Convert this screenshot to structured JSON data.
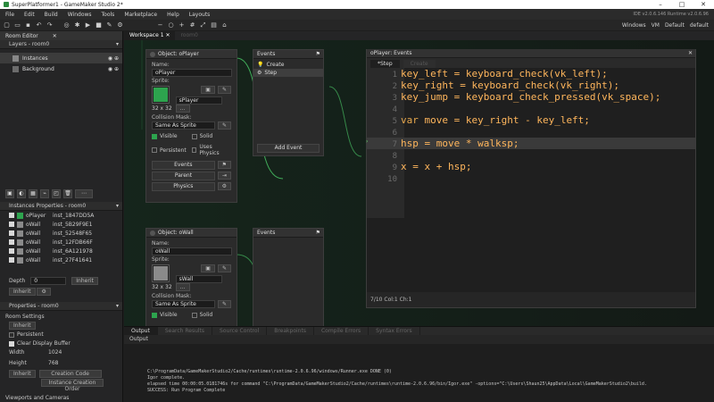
{
  "window": {
    "title": "SuperPlatformer1 - GameMaker Studio 2*",
    "controls": [
      "–",
      "□",
      "✕"
    ]
  },
  "menu": {
    "items": [
      "File",
      "Edit",
      "Build",
      "Windows",
      "Tools",
      "Marketplace",
      "Help",
      "Layouts"
    ],
    "ide_version": "IDE v2.0.6.146 Runtime v2.0.6.96"
  },
  "toolbar": {
    "right_items": [
      "Windows",
      "VM",
      "Default",
      "default"
    ]
  },
  "room_editor": {
    "tab_label": "Room Editor",
    "layers_header": "Layers - room0",
    "layers": [
      {
        "name": "Instances",
        "selected": true
      },
      {
        "name": "Background",
        "selected": false
      }
    ],
    "instances_header": "Instances Properties - room0",
    "instances": [
      {
        "object": "oPlayer",
        "id": "inst_1847DD5A",
        "color": "#2da44e"
      },
      {
        "object": "oWall",
        "id": "inst_5B29F9E1",
        "color": "#8a8a8a"
      },
      {
        "object": "oWall",
        "id": "inst_52548F65",
        "color": "#8a8a8a"
      },
      {
        "object": "oWall",
        "id": "inst_12FDB66F",
        "color": "#8a8a8a"
      },
      {
        "object": "oWall",
        "id": "inst_6A121978",
        "color": "#8a8a8a"
      },
      {
        "object": "oWall",
        "id": "inst_27F41641",
        "color": "#8a8a8a"
      }
    ],
    "depth_label": "Depth",
    "depth_value": "0",
    "inherit_label": "Inherit",
    "properties_header": "Properties - room0",
    "room_settings_label": "Room Settings",
    "persistent_label": "Persistent",
    "clear_display_label": "Clear Display Buffer",
    "width_label": "Width",
    "width_value": "1024",
    "height_label": "Height",
    "height_value": "768",
    "creation_code_label": "Creation Code",
    "creation_order_label": "Instance Creation Order",
    "viewports_label": "Viewports and Cameras"
  },
  "workspace": {
    "tabs": [
      "Workspace 1",
      "room0"
    ]
  },
  "object_player": {
    "title": "Object: oPlayer",
    "name_label": "Name:",
    "name_value": "oPlayer",
    "sprite_label": "Sprite:",
    "sprite_value": "sPlayer",
    "sprite_size": "32 x 32",
    "sprite_color": "#2da44e",
    "mask_label": "Collision Mask:",
    "mask_value": "Same As Sprite",
    "visible_label": "Visible",
    "solid_label": "Solid",
    "persistent_label": "Persistent",
    "physics_label": "Uses Physics",
    "events_button": "Events",
    "parent_button": "Parent",
    "physics_button": "Physics"
  },
  "events_player": {
    "title": "Events",
    "items": [
      {
        "label": "Create",
        "selected": false
      },
      {
        "label": "Step",
        "selected": true
      }
    ],
    "add_button": "Add Event"
  },
  "object_wall": {
    "title": "Object: oWall",
    "name_label": "Name:",
    "name_value": "oWall",
    "sprite_label": "Sprite:",
    "sprite_value": "sWall",
    "sprite_size": "32 x 32",
    "sprite_color": "#8a8a8a",
    "mask_label": "Collision Mask:",
    "mask_value": "Same As Sprite",
    "visible_label": "Visible",
    "solid_label": "Solid"
  },
  "events_wall": {
    "title": "Events"
  },
  "code_editor": {
    "title": "oPlayer: Events",
    "tabs": [
      "*Step",
      "Create"
    ],
    "lines": [
      {
        "n": "1",
        "text": "key_left = keyboard_check(vk_left);"
      },
      {
        "n": "2",
        "text": "key_right = keyboard_check(vk_right);"
      },
      {
        "n": "3",
        "text": "key_jump = keyboard_check_pressed(vk_space);"
      },
      {
        "n": "4",
        "text": ""
      },
      {
        "n": "5",
        "text_kw": "var",
        "text": " move = key_right - key_left;"
      },
      {
        "n": "6",
        "text": ""
      },
      {
        "n": "7",
        "text": "hsp = move * walksp;"
      },
      {
        "n": "8",
        "text": ""
      },
      {
        "n": "9",
        "text": "x = x + hsp;"
      },
      {
        "n": "10",
        "text": ""
      }
    ],
    "status": "7/10 Col:1 Ch:1"
  },
  "output": {
    "tabs": [
      "Output",
      "Search Results",
      "Source Control",
      "Breakpoints",
      "Compile Errors",
      "Syntax Errors"
    ],
    "header": "Output",
    "lines": [
      "C:\\ProgramData/GameMakerStudio2/Cache/runtimes\\runtime-2.0.6.96/windows/Runner.exe DONE (0)",
      "Igor complete.",
      "elapsed time 00:00:05.0181746s for command \"C:\\ProgramData/GameMakerStudio2/Cache/runtimes\\runtime-2.0.6.96/bin/Igor.exe\" -options=\"C:\\Users\\Shaun25\\AppData\\Local\\GameMakerStudio2\\build.",
      "SUCCESS: Run Program Complete"
    ]
  }
}
